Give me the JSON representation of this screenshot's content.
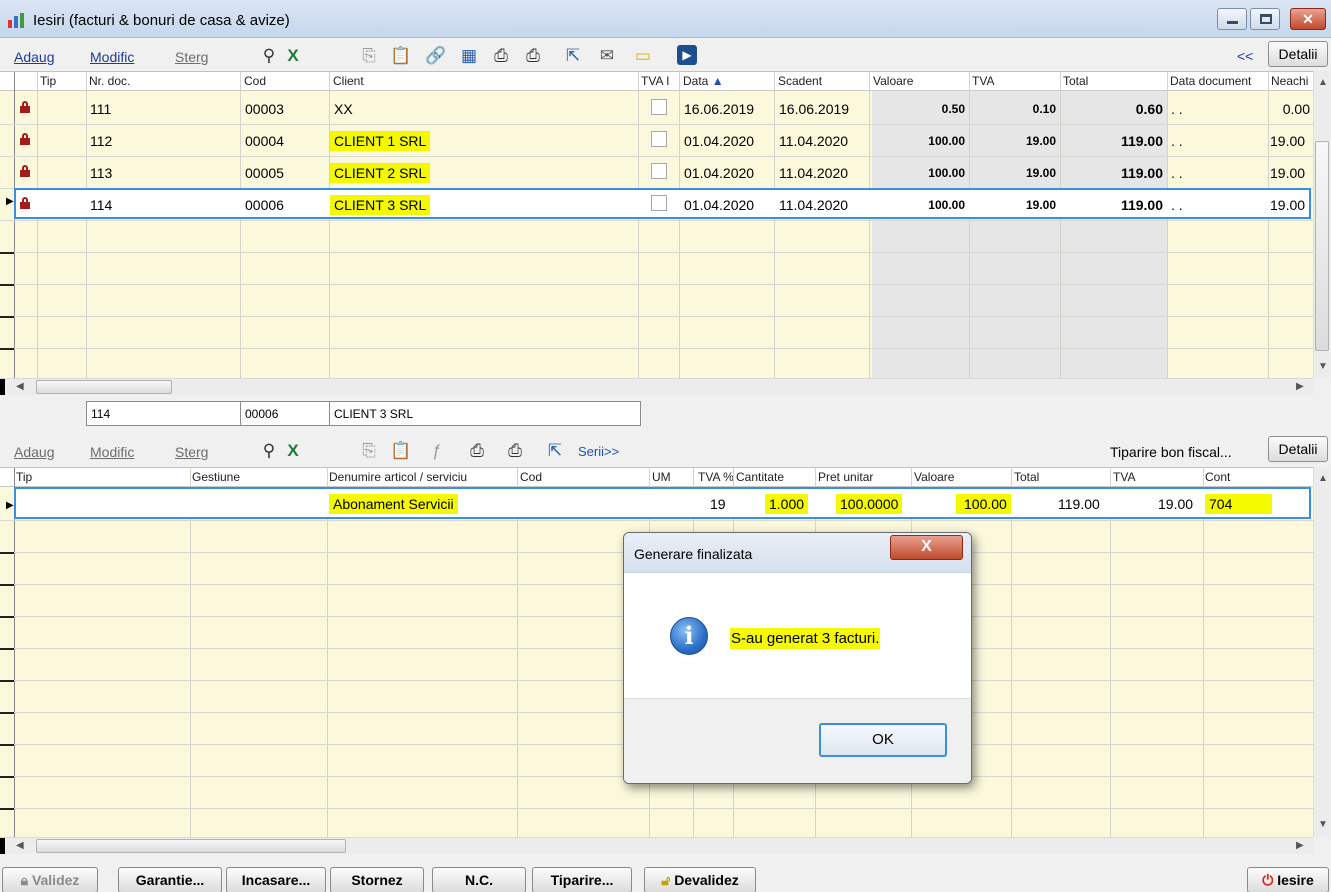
{
  "window": {
    "title": "Iesiri (facturi & bonuri de casa & avize)"
  },
  "top_toolbar": {
    "add": "Adaug",
    "modify": "Modific",
    "delete": "Sterg",
    "collapse": "<<",
    "details": "Detalii"
  },
  "invoice_grid": {
    "columns": [
      "Tip",
      "Nr. doc.",
      "Cod",
      "Client",
      "TVA I",
      "Data",
      "Scadent",
      "Valoare",
      "TVA",
      "Total",
      "Data document",
      "Neachi"
    ],
    "sort_indicator": "▲",
    "rows": [
      {
        "nr": "111",
        "cod": "00003",
        "client": "XX",
        "data": "16.06.2019",
        "scadent": "16.06.2019",
        "valoare": "0.50",
        "tva": "0.10",
        "total": "0.60",
        "data_doc": ". .",
        "neachitat": "0.00"
      },
      {
        "nr": "112",
        "cod": "00004",
        "client": "CLIENT 1 SRL",
        "data": "01.04.2020",
        "scadent": "11.04.2020",
        "valoare": "100.00",
        "tva": "19.00",
        "total": "119.00",
        "data_doc": ". .",
        "neachitat": "19.00"
      },
      {
        "nr": "113",
        "cod": "00005",
        "client": "CLIENT 2 SRL",
        "data": "01.04.2020",
        "scadent": "11.04.2020",
        "valoare": "100.00",
        "tva": "19.00",
        "total": "119.00",
        "data_doc": ". .",
        "neachitat": "19.00"
      },
      {
        "nr": "114",
        "cod": "00006",
        "client": "CLIENT 3 SRL",
        "data": "01.04.2020",
        "scadent": "11.04.2020",
        "valoare": "100.00",
        "tva": "19.00",
        "total": "119.00",
        "data_doc": ". .",
        "neachitat": "19.00"
      }
    ],
    "selected_row_index": 3
  },
  "current_doc": {
    "nr": "114",
    "cod": "00006",
    "client": "CLIENT 3 SRL"
  },
  "lines_toolbar": {
    "add": "Adaug",
    "modify": "Modific",
    "delete": "Sterg",
    "series": "Serii>>",
    "fiscal_print": "Tiparire bon fiscal...",
    "details": "Detalii"
  },
  "lines_grid": {
    "columns": [
      "Tip",
      "Gestiune",
      "Denumire articol / serviciu",
      "Cod",
      "UM",
      "TVA %",
      "Cantitate",
      "Pret unitar",
      "Valoare",
      "Total",
      "TVA",
      "Cont"
    ],
    "rows": [
      {
        "denumire": "Abonament Servicii",
        "tva_pct": "19",
        "cantitate": "1.000",
        "pret": "100.0000",
        "valoare": "100.00",
        "total": "119.00",
        "tva": "19.00",
        "cont": "704"
      }
    ]
  },
  "dialog": {
    "title": "Generare finalizata",
    "message": "S-au generat 3 facturi.",
    "ok": "OK",
    "close": "X"
  },
  "bottom_bar": {
    "validate": "Validez",
    "warranty": "Garantie...",
    "collect": "Incasare...",
    "storno": "Stornez",
    "nc": "N.C.",
    "print": "Tiparire...",
    "invalidate": "Devalidez",
    "exit": "Iesire"
  }
}
